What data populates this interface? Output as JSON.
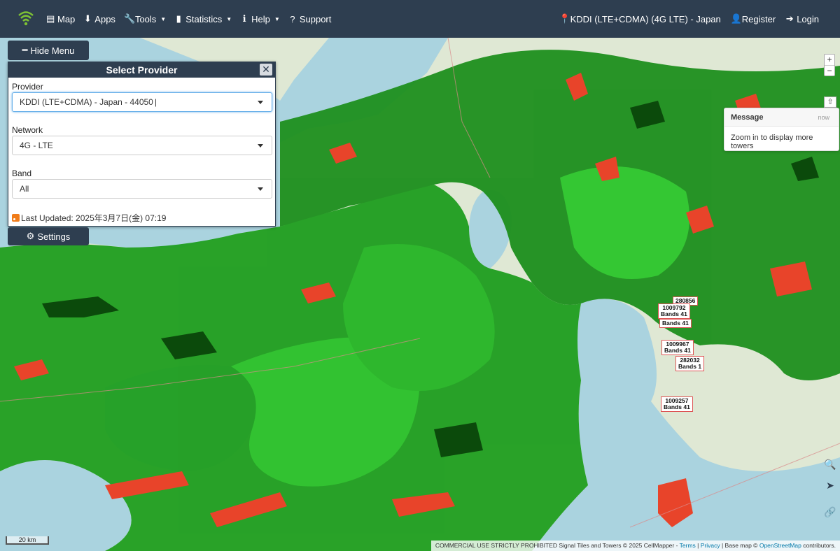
{
  "navbar": {
    "logo_icon": "wifi-signal-icon",
    "items": [
      {
        "label": "Map",
        "icon": "map-icon",
        "dropdown": false
      },
      {
        "label": "Apps",
        "icon": "download-icon",
        "dropdown": false
      },
      {
        "label": "Tools",
        "icon": "wrench-icon",
        "dropdown": true
      },
      {
        "label": "Statistics",
        "icon": "bar-chart-icon",
        "dropdown": true
      },
      {
        "label": "Help",
        "icon": "info-icon",
        "dropdown": true
      },
      {
        "label": "Support",
        "icon": "question-icon",
        "dropdown": false
      }
    ],
    "provider_status": "KDDI (LTE+CDMA) (4G LTE) - Japan",
    "register_label": "Register",
    "login_label": "Login"
  },
  "sidebar": {
    "hide_menu_label": "Hide Menu",
    "panel_title": "Select Provider",
    "provider_label": "Provider",
    "provider_value": "KDDI (LTE+CDMA) - Japan - 44050",
    "network_label": "Network",
    "network_value": "4G - LTE",
    "band_label": "Band",
    "band_value": "All",
    "last_updated": "Last Updated: 2025年3月7日(金) 07:19",
    "settings_label": "Settings"
  },
  "toast": {
    "title": "Message",
    "time": "now",
    "body": "Zoom in to display more towers"
  },
  "map_controls": {
    "zoom_in": "+",
    "zoom_out": "−"
  },
  "towers": [
    {
      "id": "280856",
      "bands": ""
    },
    {
      "id": "1009792",
      "bands": "Bands 41"
    },
    {
      "id": "",
      "bands": "Bands 41"
    },
    {
      "id": "1009967",
      "bands": "Bands 41"
    },
    {
      "id": "282032",
      "bands": "Bands 1"
    },
    {
      "id": "1009257",
      "bands": "Bands 41"
    }
  ],
  "scale": "20 km",
  "attribution": {
    "text": "COMMERCIAL USE STRICTLY PROHIBITED Signal Tiles and Towers © 2025 CellMapper -",
    "terms": "Terms",
    "privacy": "Privacy",
    "base": "Base map ©",
    "osm": "OpenStreetMap",
    "contributors": "contributors."
  },
  "colors": {
    "navbar": "#2e3e50",
    "signal_strong": "#22cc22",
    "signal_dark": "#0b4a0b",
    "signal_weak": "#e8442a",
    "water": "#aad3df",
    "land": "#dfe8d4"
  }
}
